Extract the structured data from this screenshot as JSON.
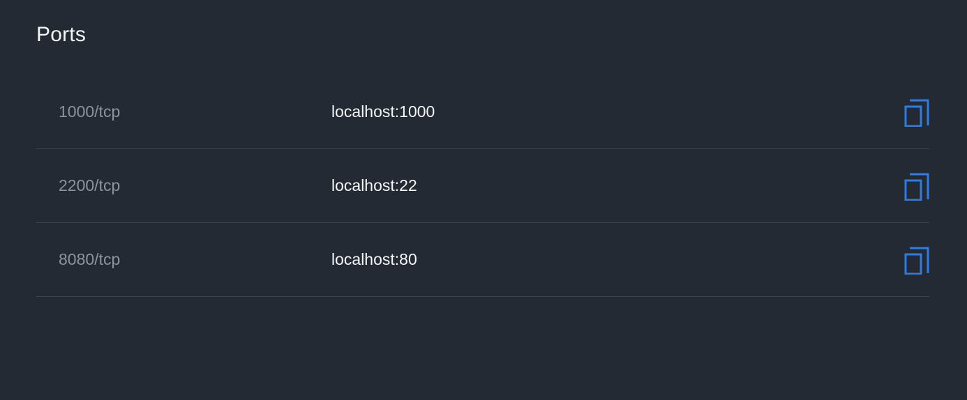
{
  "section": {
    "title": "Ports"
  },
  "colors": {
    "background": "#232a33",
    "accent": "#2f7de1",
    "divider": "#3b434d",
    "muted_text": "#8b939c"
  },
  "ports": [
    {
      "port": "1000/tcp",
      "target": "localhost:1000",
      "action_icon": "copy-icon"
    },
    {
      "port": "2200/tcp",
      "target": "localhost:22",
      "action_icon": "copy-icon"
    },
    {
      "port": "8080/tcp",
      "target": "localhost:80",
      "action_icon": "copy-icon"
    }
  ]
}
